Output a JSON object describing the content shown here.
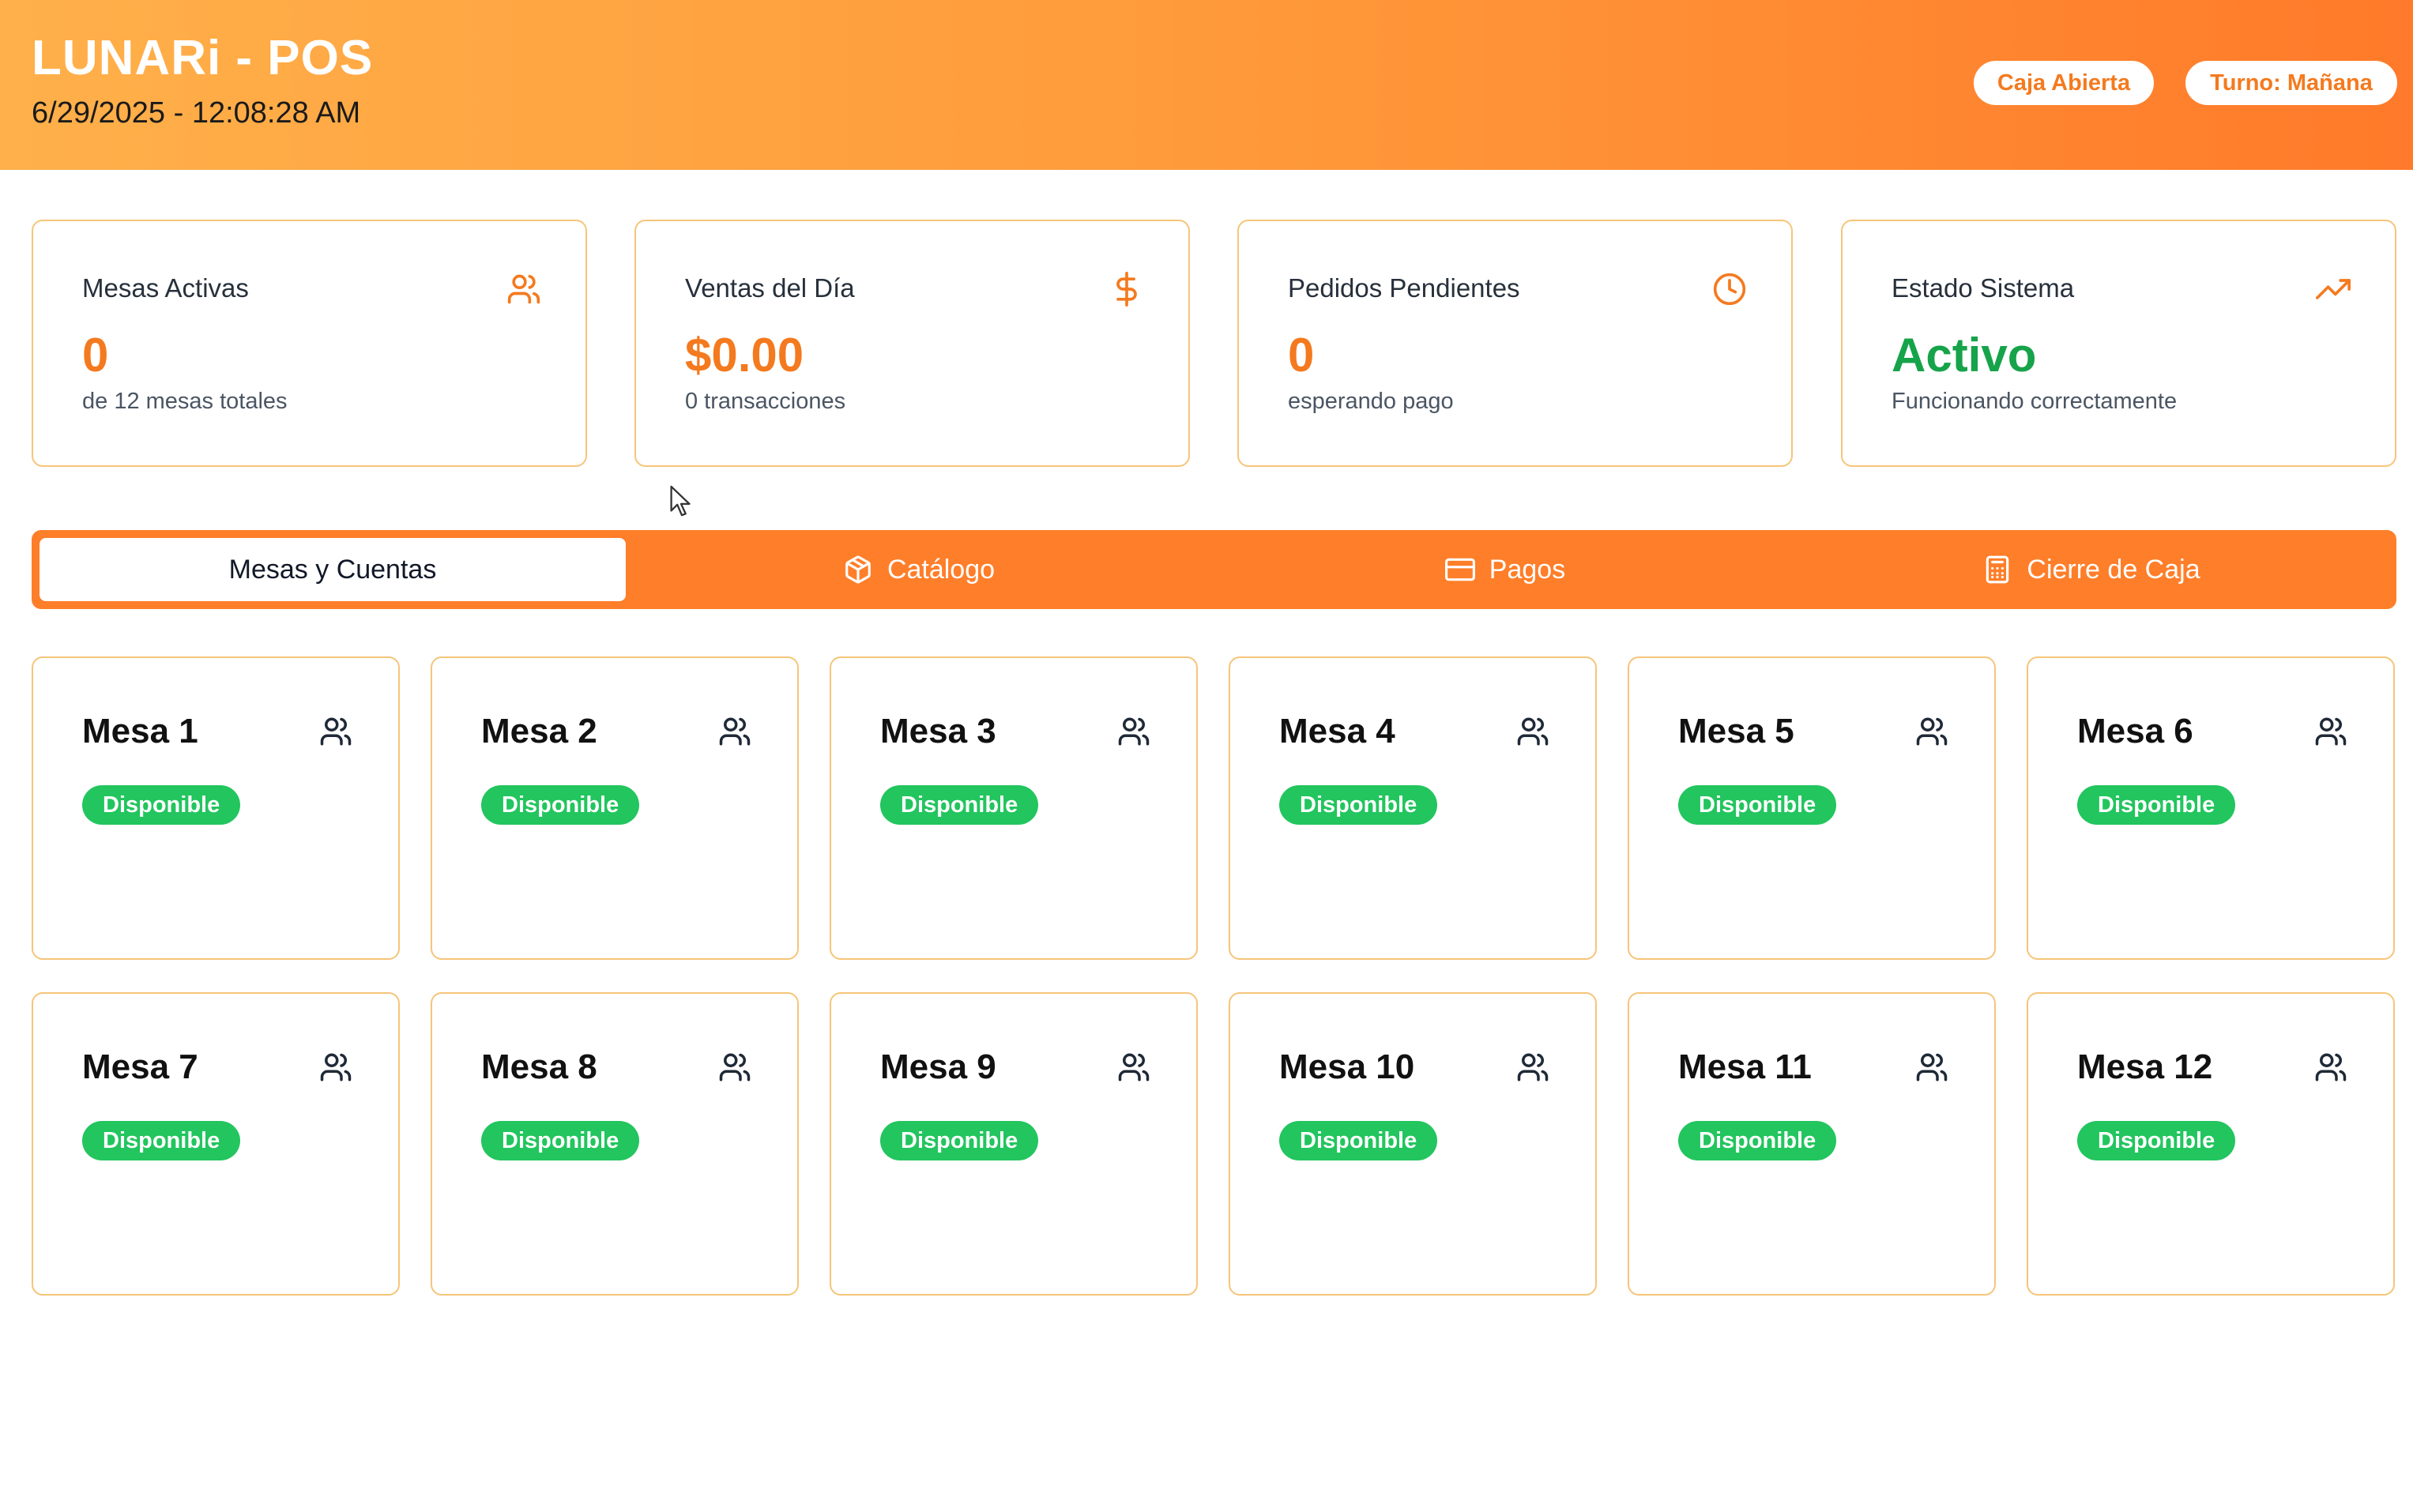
{
  "header": {
    "title": "LUNARi - POS",
    "datetime": "6/29/2025 - 12:08:28 AM",
    "status_pill": "Caja Abierta",
    "shift_pill": "Turno: Mañana"
  },
  "stats": [
    {
      "label": "Mesas Activas",
      "value": "0",
      "sub": "de 12 mesas totales",
      "icon": "users-icon"
    },
    {
      "label": "Ventas del Día",
      "value": "$0.00",
      "sub": "0 transacciones",
      "icon": "dollar-icon"
    },
    {
      "label": "Pedidos Pendientes",
      "value": "0",
      "sub": "esperando pago",
      "icon": "clock-icon"
    },
    {
      "label": "Estado Sistema",
      "value": "Activo",
      "sub": "Funcionando correctamente",
      "icon": "trending-up-icon"
    }
  ],
  "tabs": [
    {
      "label": "Mesas y Cuentas",
      "icon": "",
      "active": true
    },
    {
      "label": "Catálogo",
      "icon": "package-icon",
      "active": false
    },
    {
      "label": "Pagos",
      "icon": "credit-card-icon",
      "active": false
    },
    {
      "label": "Cierre de Caja",
      "icon": "calculator-icon",
      "active": false
    }
  ],
  "mesas": [
    {
      "name": "Mesa 1",
      "status": "Disponible"
    },
    {
      "name": "Mesa 2",
      "status": "Disponible"
    },
    {
      "name": "Mesa 3",
      "status": "Disponible"
    },
    {
      "name": "Mesa 4",
      "status": "Disponible"
    },
    {
      "name": "Mesa 5",
      "status": "Disponible"
    },
    {
      "name": "Mesa 6",
      "status": "Disponible"
    },
    {
      "name": "Mesa 7",
      "status": "Disponible"
    },
    {
      "name": "Mesa 8",
      "status": "Disponible"
    },
    {
      "name": "Mesa 9",
      "status": "Disponible"
    },
    {
      "name": "Mesa 10",
      "status": "Disponible"
    },
    {
      "name": "Mesa 11",
      "status": "Disponible"
    },
    {
      "name": "Mesa 12",
      "status": "Disponible"
    }
  ],
  "colors": {
    "accent": "#f47a1f",
    "tabbar": "#ff7e29",
    "available": "#22c55e",
    "active_status": "#16a34a",
    "card_border": "#f6c57a"
  }
}
